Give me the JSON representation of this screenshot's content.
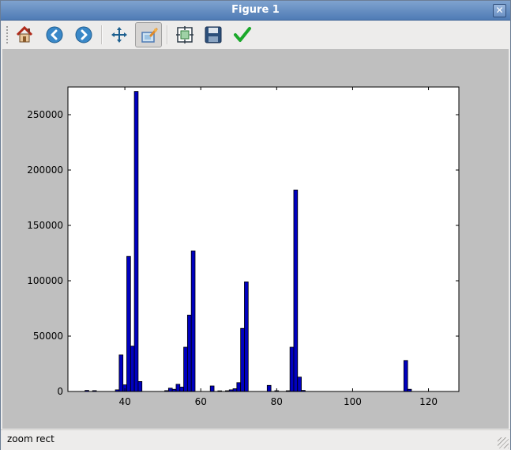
{
  "window": {
    "title": "Figure 1",
    "close_symbol": "✕"
  },
  "toolbar": {
    "buttons": [
      {
        "name": "home-icon",
        "tooltip": ""
      },
      {
        "name": "back-icon",
        "tooltip": ""
      },
      {
        "name": "forward-icon",
        "tooltip": ""
      },
      {
        "name": "pan-icon",
        "tooltip": ""
      },
      {
        "name": "zoom-icon",
        "tooltip": "",
        "active": true
      },
      {
        "name": "subplots-icon",
        "tooltip": ""
      },
      {
        "name": "save-icon",
        "tooltip": ""
      },
      {
        "name": "apply-icon",
        "tooltip": ""
      }
    ]
  },
  "status": {
    "text": "zoom rect"
  },
  "colors": {
    "bar_fill": "#0000bf",
    "bar_edge": "#000000",
    "canvas_bg": "#bfbfbf",
    "axes_bg": "#ffffff",
    "accent": "#4f7bb5"
  },
  "chart_data": {
    "type": "bar",
    "title": "",
    "xlabel": "",
    "ylabel": "",
    "xlim": [
      25,
      128
    ],
    "ylim": [
      0,
      275000
    ],
    "grid": false,
    "bar_width": 1,
    "xticks": [
      40,
      60,
      80,
      100,
      120
    ],
    "yticks": [
      0,
      50000,
      100000,
      150000,
      200000,
      250000
    ],
    "xtick_labels": [
      "40",
      "60",
      "80",
      "100",
      "120"
    ],
    "ytick_labels": [
      "0",
      "50000",
      "100000",
      "150000",
      "200000",
      "250000"
    ],
    "x": [
      30,
      32,
      38,
      39,
      40,
      41,
      42,
      43,
      44,
      51,
      52,
      53,
      54,
      55,
      56,
      57,
      58,
      63,
      65,
      67,
      68,
      69,
      70,
      71,
      72,
      78,
      80,
      83,
      84,
      85,
      86,
      87,
      114,
      115
    ],
    "values": [
      1000,
      800,
      1500,
      33000,
      6000,
      122000,
      41000,
      271000,
      9000,
      800,
      3000,
      2000,
      6500,
      4000,
      40000,
      69000,
      127000,
      5000,
      600,
      700,
      1500,
      2500,
      8000,
      57000,
      99000,
      5500,
      700,
      700,
      40000,
      182000,
      13000,
      1000,
      28000,
      2000
    ]
  }
}
